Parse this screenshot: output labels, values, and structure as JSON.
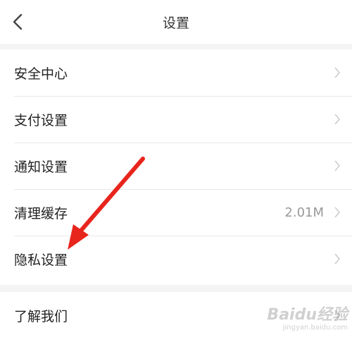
{
  "header": {
    "title": "设置"
  },
  "settings_group1": [
    {
      "label": "安全中心",
      "value": ""
    },
    {
      "label": "支付设置",
      "value": ""
    },
    {
      "label": "通知设置",
      "value": ""
    },
    {
      "label": "清理缓存",
      "value": "2.01M"
    },
    {
      "label": "隐私设置",
      "value": ""
    }
  ],
  "settings_group2": [
    {
      "label": "了解我们",
      "value": ""
    }
  ],
  "annotation": {
    "color": "#e8251d"
  },
  "watermark": {
    "main": "Baidu经验",
    "sub": "jingyan.baidu.com"
  }
}
